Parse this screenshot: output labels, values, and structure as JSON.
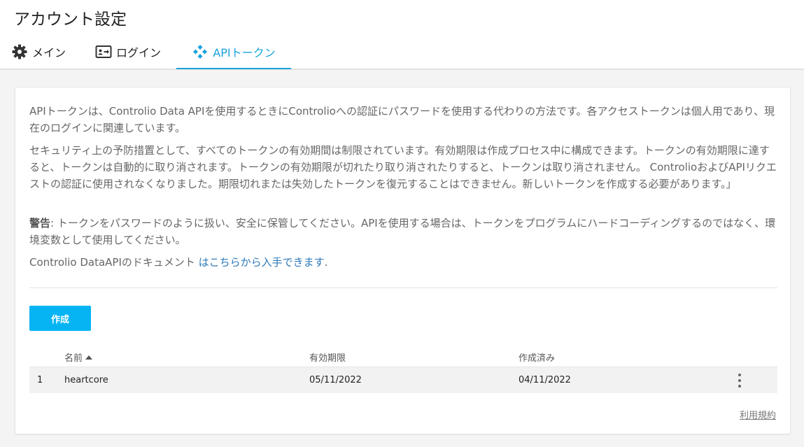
{
  "page": {
    "title": "アカウント設定"
  },
  "tabs": [
    {
      "label": "メイン",
      "icon": "gear-icon",
      "active": false
    },
    {
      "label": "ログイン",
      "icon": "id-card-icon",
      "active": false
    },
    {
      "label": "APIトークン",
      "icon": "api-diamond-icon",
      "active": true
    }
  ],
  "content": {
    "para1": "APIトークンは、Controlio Data APIを使用するときにControlioへの認証にパスワードを使用する代わりの方法です。各アクセストークンは個人用であり、現在のログインに関連しています。",
    "para2": "セキュリティ上の予防措置として、すべてのトークンの有効期間は制限されています。有効期限は作成プロセス中に構成できます。トークンの有効期限に達すると、トークンは自動的に取り消されます。トークンの有効期限が切れたり取り消されたりすると、トークンは取り消されません。 ControlioおよびAPIリクエストの認証に使用されなくなりました。期限切れまたは失効したトークンを復元することはできません。新しいトークンを作成する必要があります。」",
    "warning_label": "警告",
    "warning_text": ": トークンをパスワードのように扱い、安全に保管してください。APIを使用する場合は、トークンをプログラムにハードコーディングするのではなく、環境変数として使用してください。",
    "docs_prefix": "Controlio DataAPIのドキュメント ",
    "docs_link": "はこちらから入手できます",
    "docs_suffix": "."
  },
  "create_button": "作成",
  "table": {
    "columns": {
      "name": "名前",
      "expires": "有効期限",
      "created": "作成済み"
    },
    "rows": [
      {
        "index": "1",
        "name": "heartcore",
        "expires": "05/11/2022",
        "created": "04/11/2022"
      }
    ]
  },
  "footer": {
    "terms": "利用規約"
  },
  "colors": {
    "accent": "#1aa3de",
    "button": "#06b4f4",
    "link": "#2d79b9"
  }
}
